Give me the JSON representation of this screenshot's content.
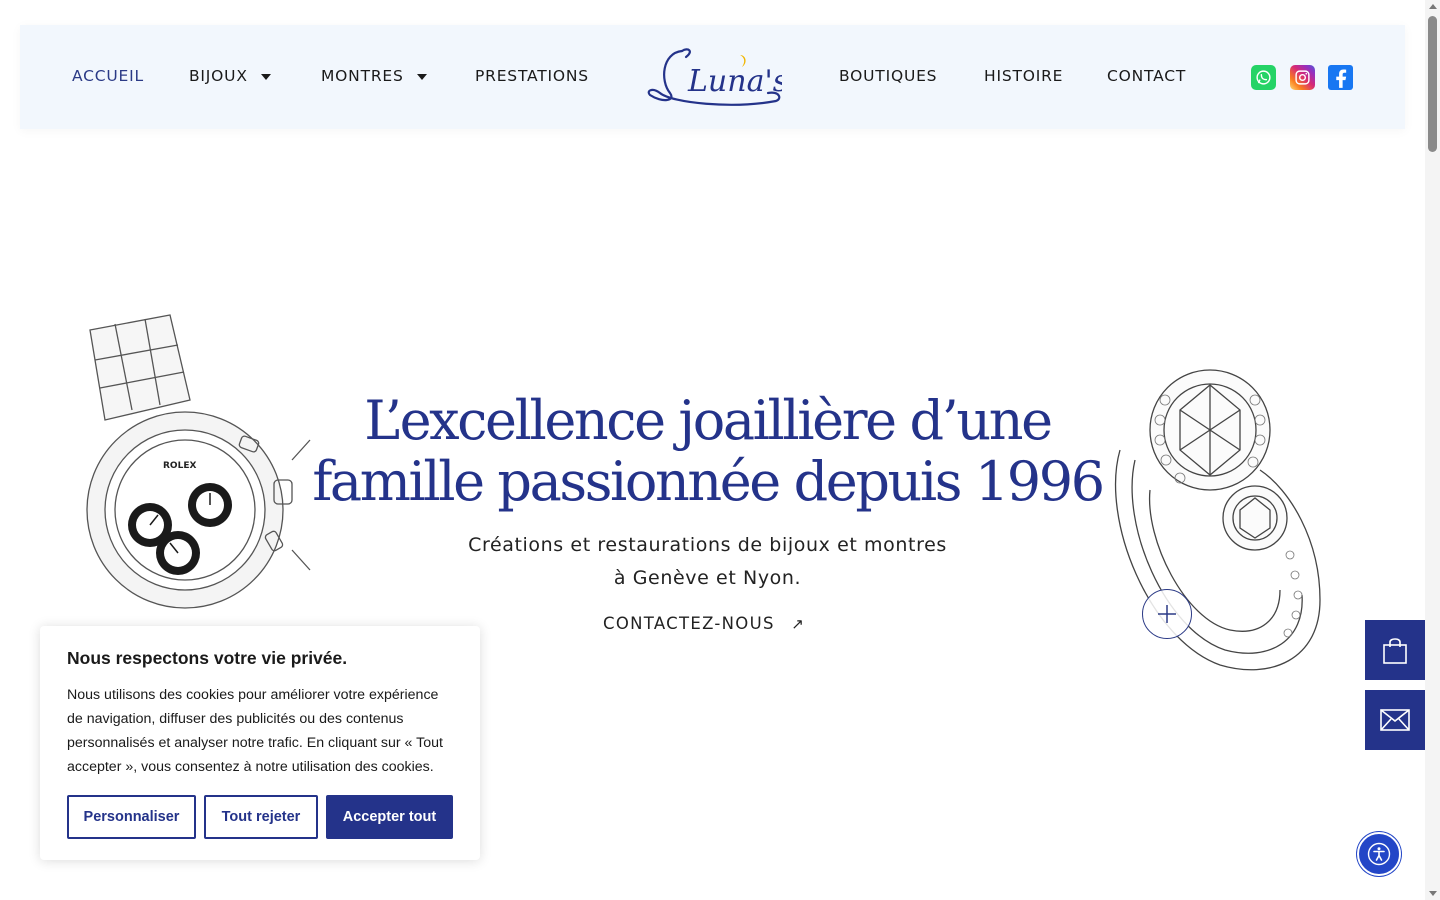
{
  "header": {
    "nav_left": [
      {
        "label": "ACCUEIL",
        "has_dropdown": false,
        "active": true
      },
      {
        "label": "BIJOUX",
        "has_dropdown": true,
        "active": false
      },
      {
        "label": "MONTRES",
        "has_dropdown": true,
        "active": false
      },
      {
        "label": "PRESTATIONS",
        "has_dropdown": false,
        "active": false
      }
    ],
    "logo_text": "Luna's",
    "nav_right": [
      {
        "label": "BOUTIQUES"
      },
      {
        "label": "HISTOIRE"
      },
      {
        "label": "CONTACT"
      }
    ],
    "social": [
      "whatsapp-icon",
      "instagram-icon",
      "facebook-icon"
    ]
  },
  "hero": {
    "title_line1": "L’excellence joaillière d’une",
    "title_line2": "famille passionnée depuis 1996",
    "subtitle_line1": "Créations et restaurations de bijoux et montres",
    "subtitle_line2": "à Genève et Nyon.",
    "cta_label": "CONTACTEZ-NOUS",
    "cta_icon": "arrow-up-right-icon",
    "watch_brand": "ROLEX"
  },
  "side_buttons": [
    "shopping-bag-icon",
    "envelope-icon"
  ],
  "cookie": {
    "title": "Nous respectons votre vie privée.",
    "text": "Nous utilisons des cookies pour améliorer votre expérience de navigation, diffuser des publicités ou des contenus personnalisés et analyser notre trafic. En cliquant sur « Tout accepter », vous consentez à notre utilisation des cookies.",
    "customize_label": "Personnaliser",
    "reject_label": "Tout rejeter",
    "accept_label": "Accepter tout"
  },
  "colors": {
    "brand": "#24338a",
    "header_bg": "#f2f7fd",
    "accessibility": "#2346c7"
  }
}
